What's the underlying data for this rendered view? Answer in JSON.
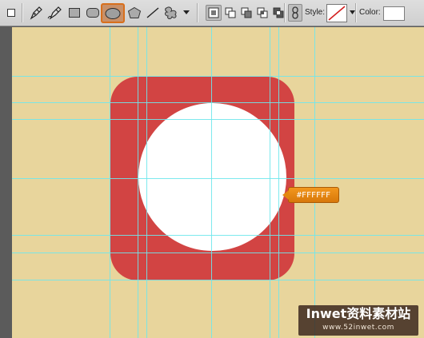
{
  "toolbar": {
    "tools": [
      {
        "name": "square-icon"
      },
      {
        "name": "pen-tool-icon"
      },
      {
        "name": "freeform-pen-icon"
      },
      {
        "name": "rectangle-tool-icon"
      },
      {
        "name": "rounded-rectangle-tool-icon"
      },
      {
        "name": "ellipse-tool-icon",
        "active": true
      },
      {
        "name": "polygon-tool-icon"
      },
      {
        "name": "line-tool-icon"
      },
      {
        "name": "custom-shape-tool-icon"
      }
    ],
    "style_label": "Style:",
    "color_label": "Color:",
    "active_color": "#d86f1c",
    "fill_color": "#FFFFFF"
  },
  "canvas": {
    "background_color": "#e8d59c",
    "icon_color": "#d24443",
    "circle_color": "#ffffff",
    "guide_color": "#6fe7ec",
    "color_tag": "#FFFFFF"
  },
  "watermark": {
    "title": "Inwet资料素材站",
    "url": "www.52inwet.com"
  }
}
